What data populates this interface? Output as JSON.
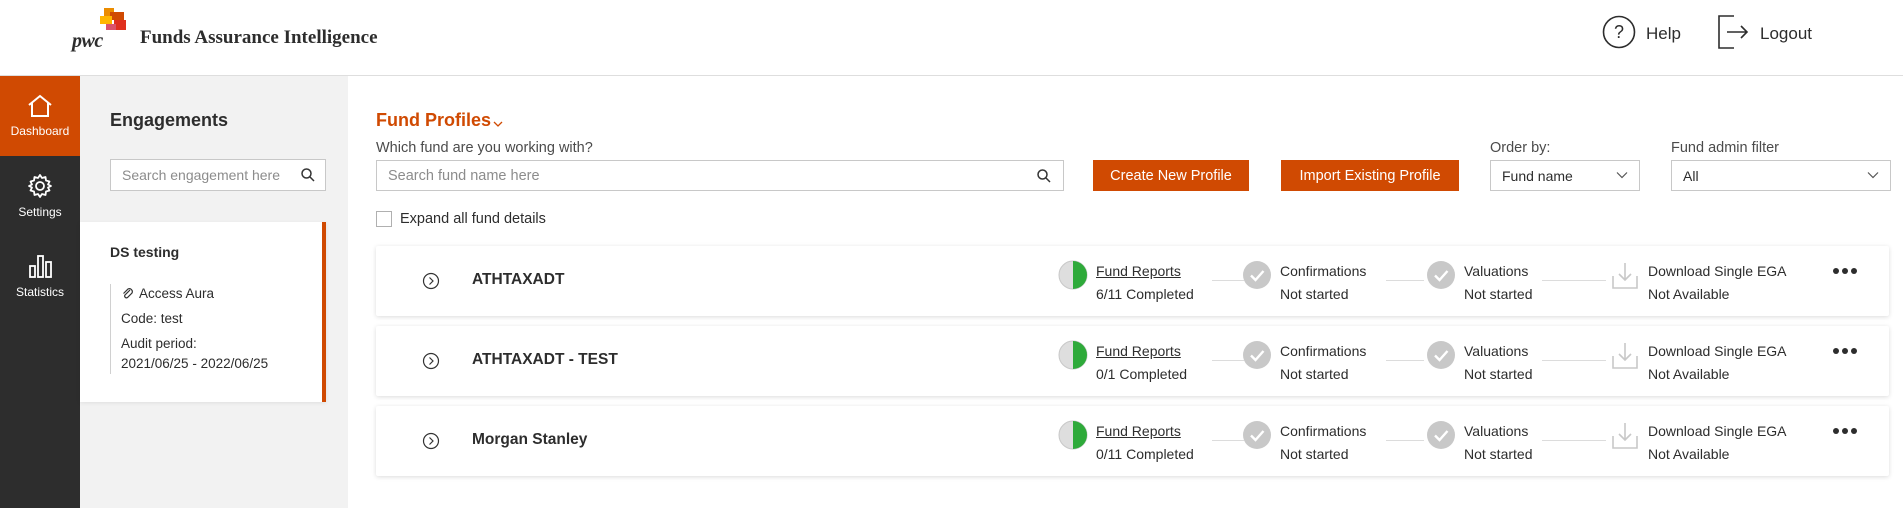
{
  "header": {
    "app_title": "Funds Assurance Intelligence",
    "logo_text": "pwc",
    "help_label": "Help",
    "logout_label": "Logout"
  },
  "rail": {
    "items": [
      {
        "label": "Dashboard",
        "icon": "home-icon",
        "active": true
      },
      {
        "label": "Settings",
        "icon": "gear-icon",
        "active": false
      },
      {
        "label": "Statistics",
        "icon": "bar-chart-icon",
        "active": false
      }
    ]
  },
  "engagements": {
    "title": "Engagements",
    "search_placeholder": "Search engagement here",
    "selected": {
      "name": "DS testing",
      "client": "Access Aura",
      "code": "Code: test",
      "audit_label": "Audit period:",
      "audit_range": "2021/06/25 - 2022/06/25"
    }
  },
  "main": {
    "title": "Fund Profiles",
    "question": "Which fund are you working with?",
    "search_placeholder": "Search fund name here",
    "create_button": "Create New Profile",
    "import_button": "Import Existing Profile",
    "order_label": "Order by:",
    "order_value": "Fund name",
    "filter_label": "Fund admin filter",
    "filter_value": "All",
    "expand_label": "Expand all fund details"
  },
  "funds": [
    {
      "name": "ATHTAXADT",
      "reports_label": "Fund Reports",
      "reports_status": "6/11 Completed",
      "confirmations_label": "Confirmations",
      "confirmations_status": "Not started",
      "valuations_label": "Valuations",
      "valuations_status": "Not started",
      "download_label": "Download Single EGA",
      "download_status": "Not Available"
    },
    {
      "name": "ATHTAXADT - TEST",
      "reports_label": "Fund Reports",
      "reports_status": "0/1 Completed",
      "confirmations_label": "Confirmations",
      "confirmations_status": "Not started",
      "valuations_label": "Valuations",
      "valuations_status": "Not started",
      "download_label": "Download Single EGA",
      "download_status": "Not Available"
    },
    {
      "name": "Morgan Stanley",
      "reports_label": "Fund Reports",
      "reports_status": "0/11 Completed",
      "confirmations_label": "Confirmations",
      "confirmations_status": "Not started",
      "valuations_label": "Valuations",
      "valuations_status": "Not started",
      "download_label": "Download Single EGA",
      "download_status": "Not Available"
    }
  ],
  "colors": {
    "brand": "#d04a02",
    "rail": "#2d2d2d",
    "progress_green": "#2eaa3a",
    "step_gray": "#c8c8c8"
  }
}
